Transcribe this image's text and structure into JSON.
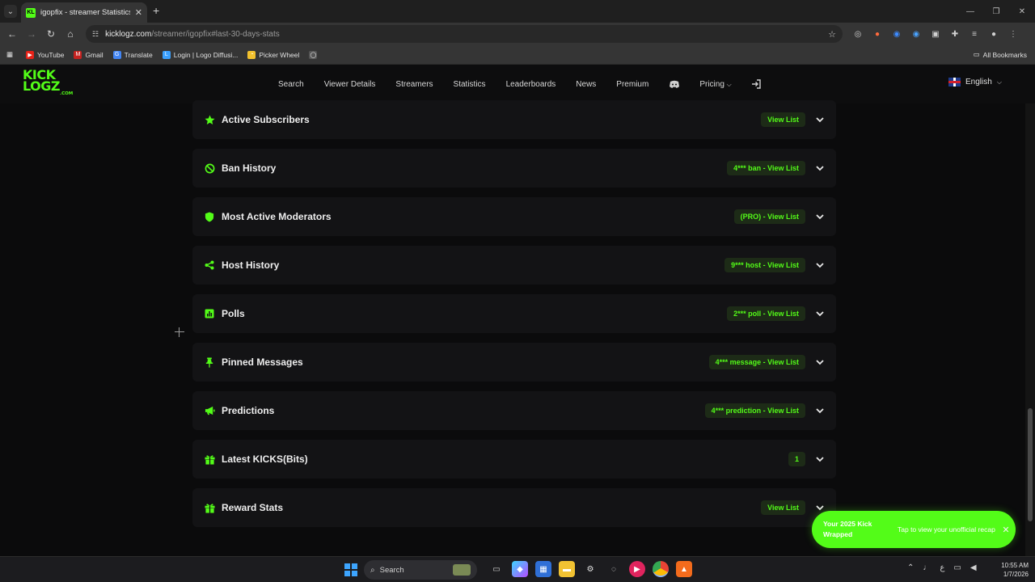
{
  "browser": {
    "tab_title": "igopfix - streamer Statistics",
    "url_host": "kicklogz.com",
    "url_path": "/streamer/igopfix#last-30-days-stats",
    "bookmarks": [
      "YouTube",
      "Gmail",
      "Translate",
      "Login | Logo Diffusi...",
      "Picker Wheel"
    ],
    "all_bookmarks_label": "All Bookmarks"
  },
  "site": {
    "logo_line1": "KICK",
    "logo_line2": "LOGZ",
    "logo_suffix": ".COM",
    "nav": [
      "Search",
      "Viewer Details",
      "Streamers",
      "Statistics",
      "Leaderboards",
      "News",
      "Premium",
      "Pricing"
    ],
    "language": "English"
  },
  "sections": [
    {
      "title": "Active Subscribers",
      "badge": "View List",
      "icon": "star-icon"
    },
    {
      "title": "Ban History",
      "badge": "4*** ban - View List",
      "icon": "ban-icon"
    },
    {
      "title": "Most Active Moderators",
      "badge": "(PRO) - View List",
      "icon": "shield-icon"
    },
    {
      "title": "Host History",
      "badge": "9*** host - View List",
      "icon": "share-icon"
    },
    {
      "title": "Polls",
      "badge": "2*** poll - View List",
      "icon": "poll-icon"
    },
    {
      "title": "Pinned Messages",
      "badge": "4*** message - View List",
      "icon": "pin-icon"
    },
    {
      "title": "Predictions",
      "badge": "4*** prediction - View List",
      "icon": "megaphone-icon"
    },
    {
      "title": "Latest KICKS(Bits)",
      "badge": "1",
      "icon": "gift-icon"
    },
    {
      "title": "Reward Stats",
      "badge": "View List",
      "icon": "gift-icon"
    }
  ],
  "toast": {
    "title": "Your 2025 Kick Wrapped",
    "subtitle": "Tap to view your unofficial recap"
  },
  "taskbar": {
    "search_label": "Search",
    "time": "10:55 AM",
    "date": "1/7/2026"
  },
  "colors": {
    "accent": "#53fc18",
    "background": "#0b0b0c",
    "card": "#131315"
  }
}
